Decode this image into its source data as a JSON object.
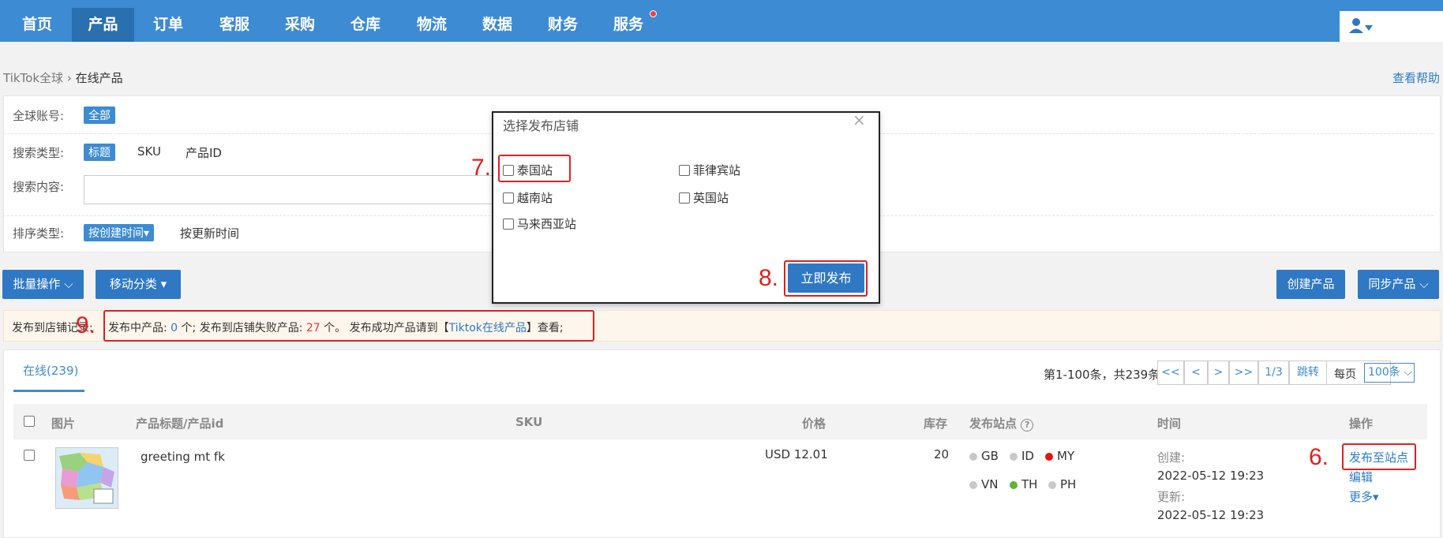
{
  "nav": {
    "items": [
      "首页",
      "产品",
      "订单",
      "客服",
      "采购",
      "仓库",
      "物流",
      "数据",
      "财务",
      "服务"
    ],
    "active_index": 1,
    "has_badge_on": "服务"
  },
  "breadcrumb": {
    "root": "TikTok全球",
    "sep": "›",
    "current": "在线产品"
  },
  "help_link": "查看帮助",
  "filters": {
    "account_label": "全球账号:",
    "account_value": "全部",
    "search_type_label": "搜索类型:",
    "search_types": [
      "标题",
      "SKU",
      "产品ID"
    ],
    "search_content_label": "搜索内容:",
    "search_content_value": "",
    "sort_label": "排序类型:",
    "sort_active": "按创建时间▾",
    "sort_other": "按更新时间"
  },
  "actions": {
    "batch": "批量操作",
    "move": "移动分类",
    "create": "创建产品",
    "sync": "同步产品"
  },
  "record_bar": {
    "prefix": "发布到店铺记录:",
    "publishing_label": "发布中产品:",
    "publishing_count": "0",
    "unit1": "个;",
    "failed_label": "发布到店铺失败产品:",
    "failed_count": "27",
    "unit2": "个。",
    "success_pre": "发布成功产品请到【",
    "success_link": "Tiktok在线产品",
    "success_post": "】查看;"
  },
  "tabs": {
    "online": "在线(239)"
  },
  "pager": {
    "info": "第1-100条，共239条",
    "first": "<<",
    "prev": "<",
    "next": ">",
    "last": ">>",
    "page": "1/3",
    "jump": "跳转",
    "per_page_label": "每页",
    "per_page_value": "100条"
  },
  "table": {
    "headers": [
      "图片",
      "产品标题/产品id",
      "SKU",
      "价格",
      "库存",
      "发布站点",
      "时间",
      "操作"
    ],
    "rows": [
      {
        "title": "greeting mt fk",
        "sku": "",
        "price": "USD  12.01",
        "stock": "20",
        "sites": [
          {
            "code": "GB",
            "color": "#c8c8c8"
          },
          {
            "code": "ID",
            "color": "#c8c8c8"
          },
          {
            "code": "MY",
            "color": "#e81010"
          },
          {
            "code": "VN",
            "color": "#c8c8c8"
          },
          {
            "code": "TH",
            "color": "#5fb236"
          },
          {
            "code": "PH",
            "color": "#c8c8c8"
          }
        ],
        "created_label": "创建:",
        "created": "2022-05-12 19:23",
        "updated_label": "更新:",
        "updated": "2022-05-12 19:23",
        "op_publish": "发布至站点",
        "op_edit": "编辑",
        "op_more": "更多▾"
      }
    ]
  },
  "modal": {
    "title": "选择发布店铺",
    "close": "×",
    "options": [
      "泰国站",
      "菲律宾站",
      "越南站",
      "英国站",
      "马来西亚站"
    ],
    "publish": "立即发布"
  },
  "annotations": {
    "a6": "6.",
    "a7": "7.",
    "a8": "8.",
    "a9": "9."
  },
  "colors": {
    "nav_bg": "#3d8bd2",
    "accent": "#2f78c4",
    "annotation": "#e02020"
  }
}
